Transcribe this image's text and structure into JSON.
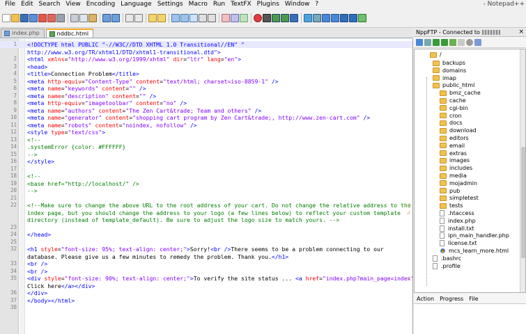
{
  "menu": [
    "File",
    "Edit",
    "Search",
    "View",
    "Encoding",
    "Language",
    "Settings",
    "Macro",
    "Run",
    "TextFX",
    "Plugins",
    "Window",
    "?"
  ],
  "title_fragment": "- Notepad++",
  "tabs": [
    {
      "label": "index.php",
      "active": false
    },
    {
      "label": "nddbc.html",
      "active": true
    }
  ],
  "code_lines": [
    {
      "n": "1",
      "html": "<span class=\"tag\">&lt;!DOCTYPE html PUBLIC \"-//W3C//DTD XHTML 1.0 Transitional//EN\" \"</span>",
      "current": true
    },
    {
      "n": "",
      "html": "<span class=\"tag\">http://www.w3.org/TR/xhtml1/DTD/xhtml1-transitional.dtd\"&gt;</span>"
    },
    {
      "n": "2",
      "html": "<span class=\"tag\">&lt;html</span> <span class=\"attr\">xmlns</span>=<span class=\"val\">\"http://www.w3.org/1999/xhtml\"</span> <span class=\"attr\">dir</span>=<span class=\"val\">\"ltr\"</span> <span class=\"attr\">lang</span>=<span class=\"val\">\"en\"</span><span class=\"tag\">&gt;</span>"
    },
    {
      "n": "3",
      "html": "<span class=\"tag\">&lt;head&gt;</span>"
    },
    {
      "n": "4",
      "html": "<span class=\"tag\">&lt;title&gt;</span>Connection Problem<span class=\"tag\">&lt;/title&gt;</span>"
    },
    {
      "n": "5",
      "html": "<span class=\"tag\">&lt;meta</span> <span class=\"attr\">http-equiv</span>=<span class=\"val\">\"Content-Type\"</span> <span class=\"attr\">content</span>=<span class=\"val\">\"text/html; charset=iso-8859-1\"</span> <span class=\"tag\">/&gt;</span>"
    },
    {
      "n": "6",
      "html": "<span class=\"tag\">&lt;meta</span> <span class=\"attr\">name</span>=<span class=\"val\">\"keywords\"</span> <span class=\"attr\">content</span>=<span class=\"val\">\"\"</span> <span class=\"tag\">/&gt;</span>"
    },
    {
      "n": "7",
      "html": "<span class=\"tag\">&lt;meta</span> <span class=\"attr\">name</span>=<span class=\"val\">\"description\"</span> <span class=\"attr\">content</span>=<span class=\"val\">\"\"</span> <span class=\"tag\">/&gt;</span>"
    },
    {
      "n": "8",
      "html": "<span class=\"tag\">&lt;meta</span> <span class=\"attr\">http-equiv</span>=<span class=\"val\">\"imagetoolbar\"</span> <span class=\"attr\">content</span>=<span class=\"val\">\"no\"</span> <span class=\"tag\">/&gt;</span>"
    },
    {
      "n": "9",
      "html": "<span class=\"tag\">&lt;meta</span> <span class=\"attr\">name</span>=<span class=\"val\">\"authors\"</span> <span class=\"attr\">content</span>=<span class=\"val\">\"The Zen Cart&amp;trade; Team and others\"</span> <span class=\"tag\">/&gt;</span>"
    },
    {
      "n": "10",
      "html": "<span class=\"tag\">&lt;meta</span> <span class=\"attr\">name</span>=<span class=\"val\">\"generator\"</span> <span class=\"attr\">content</span>=<span class=\"val\">\"shopping cart program by Zen Cart&amp;trade;, http://www.zen-cart.com\"</span> <span class=\"tag\">/&gt;</span>"
    },
    {
      "n": "11",
      "html": "<span class=\"tag\">&lt;meta</span> <span class=\"attr\">name</span>=<span class=\"val\">\"robots\"</span> <span class=\"attr\">content</span>=<span class=\"val\">\"noindex, nofollow\"</span> <span class=\"tag\">/&gt;</span>"
    },
    {
      "n": "12",
      "html": "<span class=\"tag\">&lt;style</span> <span class=\"attr\">type</span>=<span class=\"val\">\"text/css\"</span><span class=\"tag\">&gt;</span>"
    },
    {
      "n": "13",
      "html": "<span class=\"cmt\">&lt;!--</span>"
    },
    {
      "n": "14",
      "html": "<span class=\"cmt\">.systemError {color: #FFFFFF}</span>"
    },
    {
      "n": "15",
      "html": "<span class=\"cmt\">--&gt;</span>"
    },
    {
      "n": "16",
      "html": "<span class=\"tag\">&lt;/style&gt;</span>"
    },
    {
      "n": "17",
      "html": ""
    },
    {
      "n": "18",
      "html": "<span class=\"cmt\">&lt;!--</span>"
    },
    {
      "n": "19",
      "html": "<span class=\"cmt\">&lt;base href=\"http://localhost/\" /&gt;</span>"
    },
    {
      "n": "20",
      "html": "<span class=\"cmt\">--&gt;</span>"
    },
    {
      "n": "21",
      "html": ""
    },
    {
      "n": "22",
      "html": "<span class=\"cmt\">&lt;!--Make sure to change the above URL to the root address of your cart. Do not change the relative address to the</span>",
      "wrap": true
    },
    {
      "n": "",
      "html": "<span class=\"cmt\">index page, but you should change the address to your logo (a few lines below) to reflect your custom template</span>",
      "wrap": true
    },
    {
      "n": "",
      "html": "<span class=\"cmt\">directory (instead of template_default). Be sure to adjust the logo size to match yours. --&gt;</span>"
    },
    {
      "n": "23",
      "html": ""
    },
    {
      "n": "24",
      "html": "<span class=\"tag\">&lt;/head&gt;</span>"
    },
    {
      "n": "25",
      "html": ""
    },
    {
      "n": "32",
      "html": "<span class=\"tag\">&lt;h1</span> <span class=\"attr\">style</span>=<span class=\"val\">\"font-size: 95%; text-align: center;\"</span><span class=\"tag\">&gt;</span>Sorry!<span class=\"tag\">&lt;br /&gt;</span>There seems to be a problem connecting to our"
    },
    {
      "n": "",
      "html": "database. Please give us a few minutes to remedy the problem. Thank you.<span class=\"tag\">&lt;/h1&gt;</span>"
    },
    {
      "n": "33",
      "html": "<span class=\"tag\">&lt;br /&gt;</span>"
    },
    {
      "n": "34",
      "html": "<span class=\"tag\">&lt;br /&gt;</span>"
    },
    {
      "n": "35",
      "html": "<span class=\"tag\">&lt;div</span> <span class=\"attr\">style</span>=<span class=\"val\">\"font-size: 90%; text-align: center;\"</span><span class=\"tag\">&gt;</span>To verify the site status ... <span class=\"tag\">&lt;a</span> <span class=\"attr\">href</span>=<span class=\"val\">\"index.php?main_page=index\"</span>",
      "wrap": true
    },
    {
      "n": "",
      "html": "Click here<span class=\"tag\">&lt;/a&gt;&lt;/div&gt;</span>"
    },
    {
      "n": "36",
      "html": "<span class=\"tag\">&lt;/div&gt;</span>"
    },
    {
      "n": "37",
      "html": "<span class=\"tag\">&lt;/body&gt;&lt;/html&gt;</span>"
    },
    {
      "n": "38",
      "html": ""
    }
  ],
  "nppftp": {
    "header": "NppFTP - Connected to",
    "root": "/",
    "items": [
      {
        "label": "backups",
        "type": "folder",
        "depth": 1
      },
      {
        "label": "domains",
        "type": "folder",
        "depth": 1
      },
      {
        "label": "imap",
        "type": "folder",
        "depth": 1
      },
      {
        "label": "public_html",
        "type": "folder",
        "depth": 1
      },
      {
        "label": "bmz_cache",
        "type": "folder",
        "depth": 2
      },
      {
        "label": "cache",
        "type": "folder",
        "depth": 2
      },
      {
        "label": "cgi-bin",
        "type": "folder",
        "depth": 2
      },
      {
        "label": "cron",
        "type": "folder",
        "depth": 2
      },
      {
        "label": "docs",
        "type": "folder",
        "depth": 2
      },
      {
        "label": "download",
        "type": "folder",
        "depth": 2
      },
      {
        "label": "editors",
        "type": "folder",
        "depth": 2
      },
      {
        "label": "email",
        "type": "folder",
        "depth": 2
      },
      {
        "label": "extras",
        "type": "folder",
        "depth": 2
      },
      {
        "label": "images",
        "type": "folder",
        "depth": 2
      },
      {
        "label": "includes",
        "type": "folder",
        "depth": 2
      },
      {
        "label": "media",
        "type": "folder",
        "depth": 2
      },
      {
        "label": "mojadmin",
        "type": "folder",
        "depth": 2
      },
      {
        "label": "pub",
        "type": "folder",
        "depth": 2
      },
      {
        "label": "simpletest",
        "type": "folder",
        "depth": 2
      },
      {
        "label": "tests",
        "type": "folder",
        "depth": 2
      },
      {
        "label": ".htaccess",
        "type": "file",
        "depth": 2
      },
      {
        "label": "index.php",
        "type": "file",
        "depth": 2
      },
      {
        "label": "install.txt",
        "type": "file",
        "depth": 2
      },
      {
        "label": "ipn_main_handler.php",
        "type": "file",
        "depth": 2
      },
      {
        "label": "license.txt",
        "type": "file",
        "depth": 2
      },
      {
        "label": "mcs_learn_more.html",
        "type": "chrome",
        "depth": 2
      },
      {
        "label": ".bashrc",
        "type": "file",
        "depth": 1
      },
      {
        "label": ".profile",
        "type": "file",
        "depth": 1
      }
    ],
    "queue_tabs": [
      "Action",
      "Progress",
      "File"
    ]
  },
  "colors": {
    "tag": "#0000ff",
    "attribute": "#ff0000",
    "value": "#8000ff",
    "comment": "#008000",
    "active_tab_accent": "#f5a623"
  }
}
